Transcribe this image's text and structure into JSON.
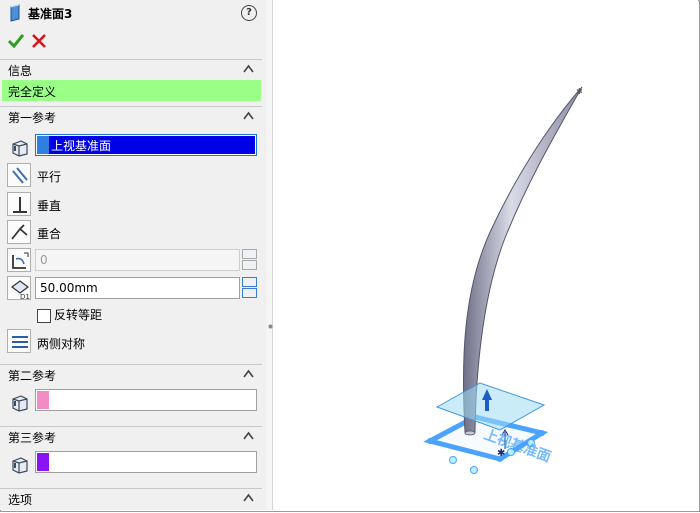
{
  "panel": {
    "title": "基准面3",
    "help_label": "?",
    "info_section": {
      "label": "信息"
    },
    "status_text": "完全定义",
    "status_color": "#99ff87",
    "first_ref": {
      "label": "第一参考",
      "selection": "上视基准面",
      "selection_color": "#2f7fe0",
      "options": [
        "平行",
        "垂直",
        "重合"
      ],
      "angle_value": "0",
      "distance_value": "50.00mm",
      "flip_label": "反转等距",
      "flip_checked": false,
      "symmetric_label": "两侧对称"
    },
    "second_ref": {
      "label": "第二参考",
      "selection": "",
      "selection_color": "#f28cc4"
    },
    "third_ref": {
      "label": "第三参考",
      "selection": "",
      "selection_color": "#8a12f5"
    },
    "options_section": {
      "label": "选项"
    }
  },
  "viewport": {
    "plane_label": "上视基准面",
    "accent": "#4aa3ff"
  }
}
